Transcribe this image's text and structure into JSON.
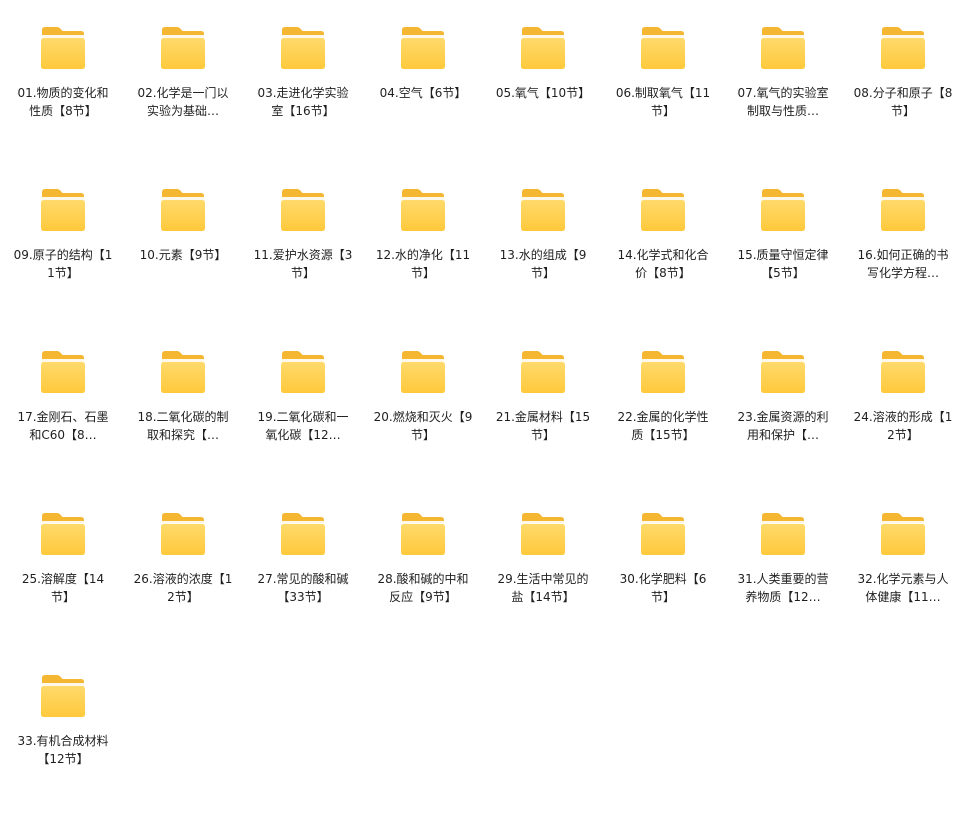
{
  "folders": [
    {
      "label": "01.物质的变化和性质【8节】"
    },
    {
      "label": "02.化学是一门以实验为基础…"
    },
    {
      "label": "03.走进化学实验室【16节】"
    },
    {
      "label": "04.空气【6节】"
    },
    {
      "label": "05.氧气【10节】"
    },
    {
      "label": "06.制取氧气【11节】"
    },
    {
      "label": "07.氧气的实验室制取与性质…"
    },
    {
      "label": "08.分子和原子【8节】"
    },
    {
      "label": "09.原子的结构【11节】"
    },
    {
      "label": "10.元素【9节】"
    },
    {
      "label": "11.爱护水资源【3节】"
    },
    {
      "label": "12.水的净化【11节】"
    },
    {
      "label": "13.水的组成【9节】"
    },
    {
      "label": "14.化学式和化合价【8节】"
    },
    {
      "label": "15.质量守恒定律【5节】"
    },
    {
      "label": "16.如何正确的书写化学方程…"
    },
    {
      "label": "17.金刚石、石墨和C60【8…"
    },
    {
      "label": "18.二氧化碳的制取和探究【…"
    },
    {
      "label": "19.二氧化碳和一氧化碳【12…"
    },
    {
      "label": "20.燃烧和灭火【9节】"
    },
    {
      "label": "21.金属材料【15节】"
    },
    {
      "label": "22.金属的化学性质【15节】"
    },
    {
      "label": "23.金属资源的利用和保护【…"
    },
    {
      "label": "24.溶液的形成【12节】"
    },
    {
      "label": "25.溶解度【14节】"
    },
    {
      "label": "26.溶液的浓度【12节】"
    },
    {
      "label": "27.常见的酸和碱【33节】"
    },
    {
      "label": "28.酸和碱的中和反应【9节】"
    },
    {
      "label": "29.生活中常见的盐【14节】"
    },
    {
      "label": "30.化学肥料【6节】"
    },
    {
      "label": "31.人类重要的营养物质【12…"
    },
    {
      "label": "32.化学元素与人体健康【11…"
    },
    {
      "label": "33.有机合成材料【12节】"
    }
  ],
  "icon": "folder-icon",
  "colors": {
    "folder_back": "#F5B731",
    "folder_front_top": "#FFDA6B",
    "folder_front_bottom": "#FFC93C",
    "text": "#1f1f1f",
    "background": "#ffffff"
  }
}
